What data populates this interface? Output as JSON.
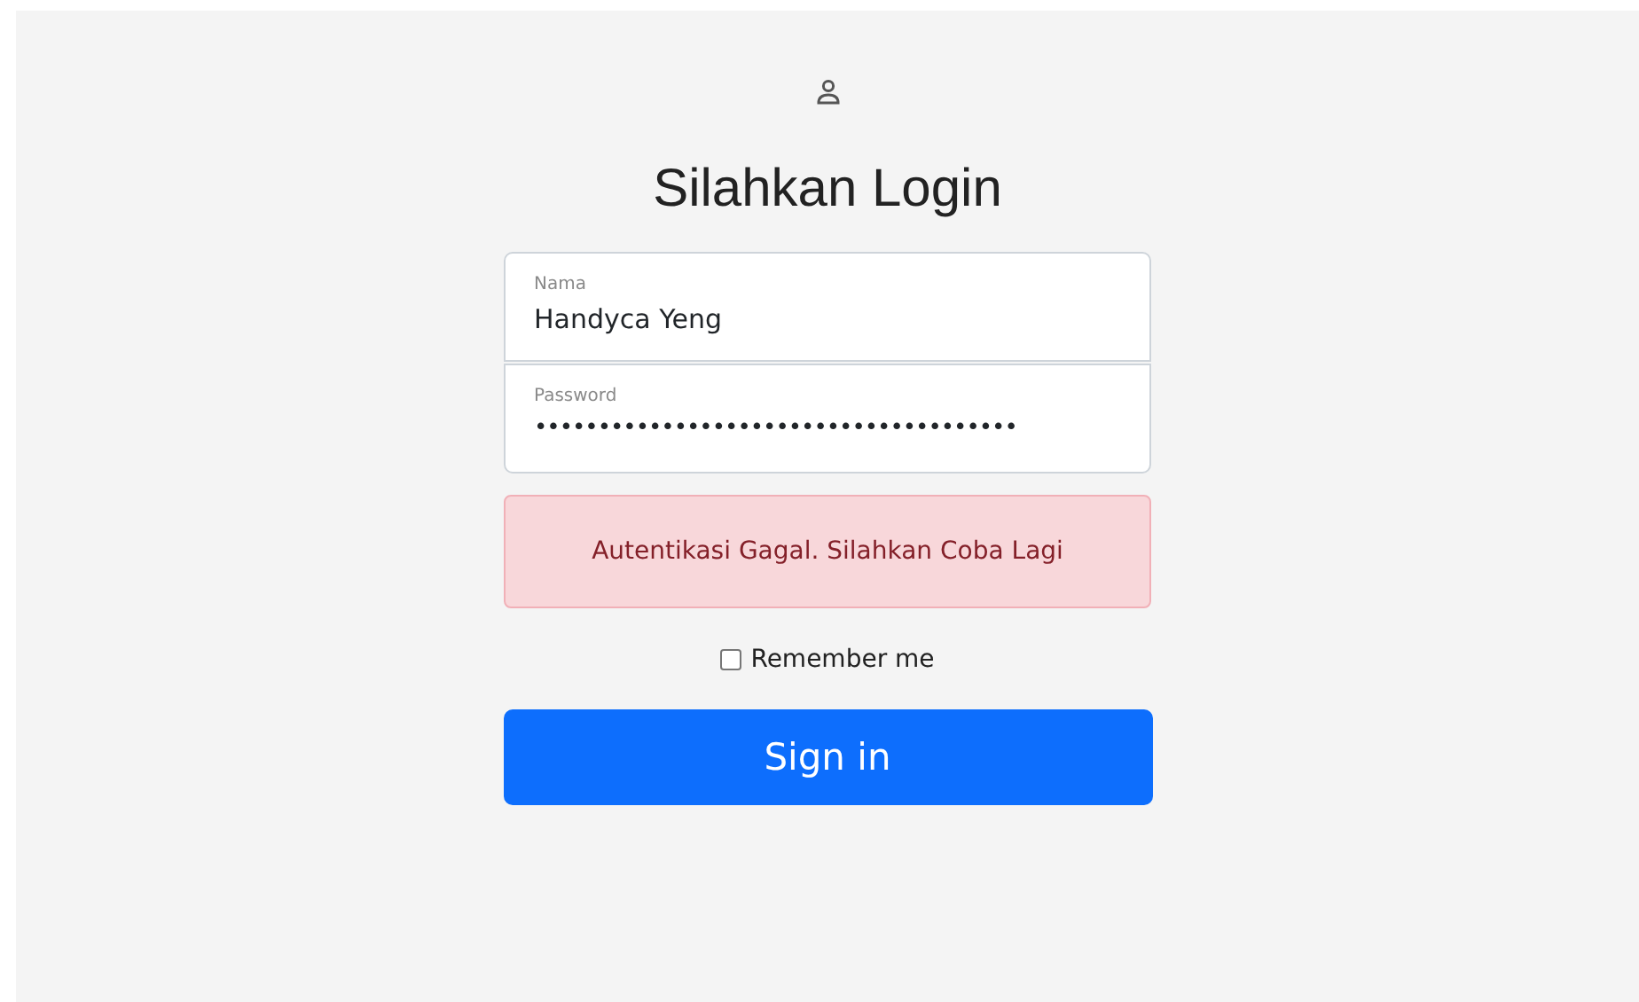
{
  "heading": "Silahkan Login",
  "fields": [
    {
      "label": "Nama",
      "value": "Handyca Yeng",
      "kind": "text"
    },
    {
      "label": "Password",
      "value": "••••••••••••••••••••••••••••••••••••••",
      "kind": "password"
    }
  ],
  "alert": "Autentikasi Gagal. Silahkan Coba Lagi",
  "remember": {
    "label": "Remember me",
    "checked": false
  },
  "button": "Sign in"
}
